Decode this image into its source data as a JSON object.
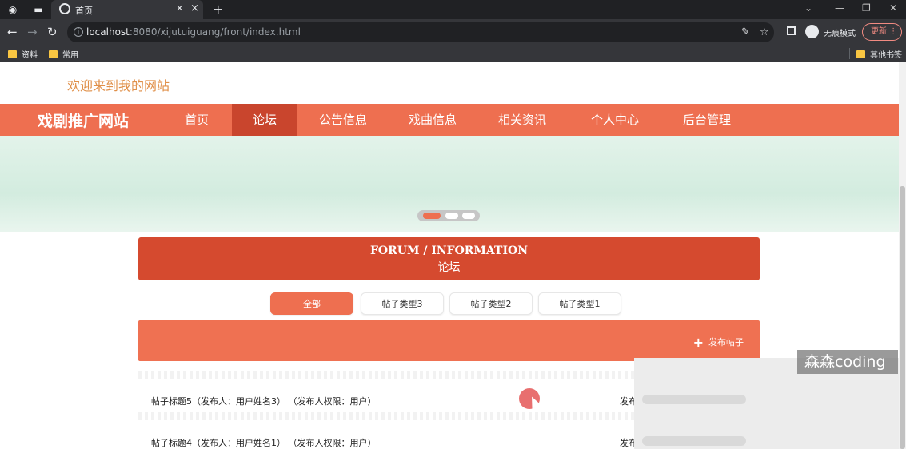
{
  "browser": {
    "tab_title": "首页",
    "url_host": "localhost",
    "url_rest": ":8080/xijutuiguang/front/index.html",
    "incognito_label": "无痕模式",
    "update_label": "更新",
    "bookmarks": [
      "资料",
      "常用"
    ],
    "other_bookmarks": "其他书签"
  },
  "page": {
    "welcome": "欢迎来到我的网站",
    "site_title": "戏剧推广网站",
    "nav": [
      "首页",
      "论坛",
      "公告信息",
      "戏曲信息",
      "相关资讯",
      "个人中心",
      "后台管理"
    ],
    "active_nav": "论坛",
    "section_en": "FORUM / INFORMATION",
    "section_cn": "论坛",
    "filters": [
      "全部",
      "帖子类型3",
      "帖子类型2",
      "帖子类型1"
    ],
    "active_filter": "全部",
    "publish_label": "发布帖子",
    "posts": [
      {
        "title": "帖子标题5（发布人：用户姓名3） （发布人权限：用户）",
        "meta": "发布"
      },
      {
        "title": "帖子标题4（发布人：用户姓名1） （发布人权限：用户）",
        "meta": "发布"
      }
    ]
  },
  "watermark": "森森coding",
  "colors": {
    "accent": "#ee6f50",
    "nav_active": "#c9452d",
    "section_head": "#d54a2f",
    "welcome": "#e0904a"
  },
  "icons": [
    "globe-icon",
    "info-icon",
    "plus-icon",
    "folder-icon",
    "star-icon",
    "incognito-icon"
  ]
}
